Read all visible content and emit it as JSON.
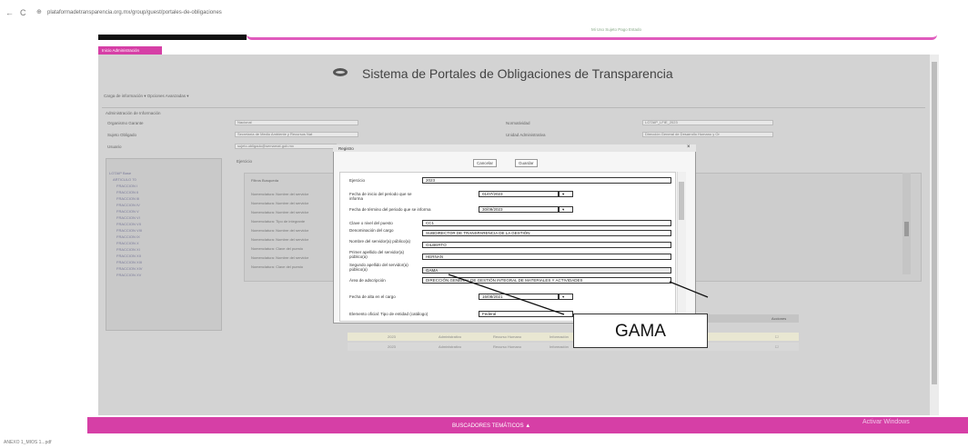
{
  "browser": {
    "back": "←",
    "reload": "C",
    "url": "plataformadetransparencia.org.mx/group/guest/portales-de-obligaciones"
  },
  "header": {
    "user": "Mi Uso Sujeto Pago Estado"
  },
  "menu": {
    "tab": "Inicio Administración"
  },
  "app": {
    "title": "Sistema de Portales de Obligaciones de Transparencia",
    "breadcrumb": "Carga de información  ▾    Opciones Avanzadas ▾"
  },
  "info": {
    "section_label": "Administración de Información",
    "fields": [
      {
        "label": "Organismo Garante",
        "value": "Nacional"
      },
      {
        "label": "Sujeto Obligado",
        "value": "Secretaría de Medio Ambiente y Recursos Nat"
      },
      {
        "label": "Usuario",
        "value": "sujeto.obligado@semarnat.gob.mx"
      },
      {
        "label": "Normatividad",
        "value": "LGTAIP_LFIE_2023"
      },
      {
        "label": "Unidad Administrativa",
        "value": "Dirección General de Desarrollo Humano y Or"
      },
      {
        "label": "Ejercicio",
        "value": ""
      }
    ]
  },
  "tree": {
    "items": [
      "LGTAIP Base",
      "ARTICULO 70",
      "FRACCION I",
      "FRACCION II",
      "FRACCION III",
      "FRACCION IV",
      "FRACCION V",
      "FRACCION VI",
      "FRACCION VII",
      "FRACCION VIII",
      "FRACCION IX",
      "FRACCION X",
      "FRACCION XI",
      "FRACCION XII",
      "FRACCION XIII",
      "FRACCION XIV",
      "FRACCION XV"
    ]
  },
  "right_panel": {
    "title": "Filtros Busqueda",
    "rows": [
      "Nomenclatura: Nombre del servidor",
      "Nomenclatura: Nombre del servidor",
      "Nomenclatura: Nombre del servidor",
      "Nomenclatura: Tipo de integrante",
      "Nomenclatura: Nombre del servidor",
      "Nomenclatura: Nombre del servidor",
      "Nomenclatura: Clave del puesto",
      "Nomenclatura: Nombre del servidor",
      "Nomenclatura: Clave del puesto"
    ]
  },
  "table": {
    "headers": [
      "",
      "",
      "",
      "",
      "",
      "",
      "Acciones"
    ],
    "rows": [
      [
        "2023",
        "Administrativo",
        "Recurso Humano",
        "Información",
        "",
        "Informativo",
        "☐"
      ],
      [
        "2023",
        "Administrativo",
        "Recurso Humano",
        "Información",
        "",
        "Informativo",
        "☐"
      ]
    ]
  },
  "dialog": {
    "title": "Registro",
    "close": "×",
    "buttons": [
      "Cancelar",
      "Guardar"
    ],
    "fields": [
      {
        "label": "Ejercicio",
        "value": "2023"
      },
      {
        "label": "Fecha de inicio del periodo que se informa",
        "value": "01/07/2023"
      },
      {
        "label": "Fecha de término del periodo que se informa",
        "value": "30/09/2023"
      },
      {
        "label": "Clave o nivel del puesto",
        "value": "CC1"
      },
      {
        "label": "Denominación del cargo",
        "value": "SUBDIRECTOR DE TRANSPARENCIA DE LA GESTIÓN"
      },
      {
        "label": "Nombre del servidor(a) público(a)",
        "value": "GILBERTO"
      },
      {
        "label": "Primer apellido del servidor(a) público(a)",
        "value": "HERNAN"
      },
      {
        "label": "Segundo apellido del servidor(a) público(a)",
        "value": "GAMA"
      },
      {
        "label": "Área de adscripción",
        "value": "DIRECCIÓN GENERAL DE GESTIÓN INTEGRAL DE MATERIALES Y ACTIVIDADES"
      },
      {
        "label": "Fecha de alta en el cargo",
        "value": "16/08/2021"
      },
      {
        "label": "Elemento oficial: Tipo de entidad (catálogo)",
        "value": "Federal"
      }
    ]
  },
  "callout": {
    "text": "GAMA"
  },
  "footer": {
    "label": "BUSCADORES TEMÁTICOS  ▲",
    "watermark": "Activar Windows"
  },
  "downloads": {
    "file": "ANEXO 1_MIOS 1...pdf"
  },
  "colors": {
    "accent": "#d63fa6",
    "panel": "#d3d3d3"
  }
}
